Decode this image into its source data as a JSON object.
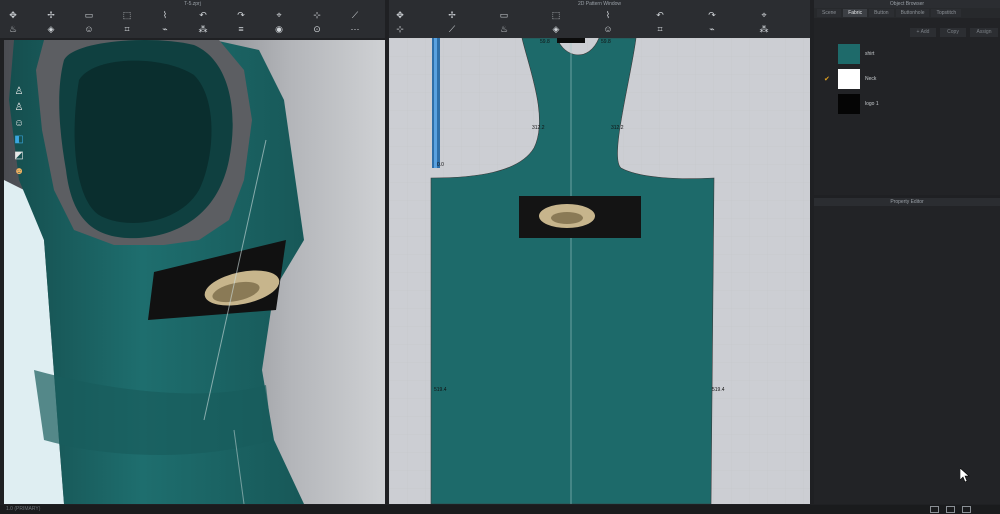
{
  "window3d": {
    "title": "T-5.zprj"
  },
  "window2d": {
    "title": "2D Pattern Window"
  },
  "object_browser": {
    "title": "Object Browser",
    "tabs": [
      "Scene",
      "Fabric",
      "Button",
      "Buttonhole",
      "Topstitch"
    ],
    "active_tab": "Fabric",
    "buttons": {
      "add": "+ Add",
      "copy": "Copy",
      "assign": "Assign"
    },
    "fabrics": [
      {
        "name": "shirt",
        "color": "#1e6a6a",
        "selected": false
      },
      {
        "name": "Neck",
        "color": "#ffffff",
        "selected": true
      },
      {
        "name": "logo 1",
        "color": "#050505",
        "selected": false
      }
    ]
  },
  "property_editor": {
    "title": "Property Editor"
  },
  "measurements": {
    "top_left": "59.8",
    "top_right": "59.8",
    "arm_left": "312.2",
    "arm_right": "312.2",
    "side_left": "519.4",
    "side_right": "519.4",
    "strip": "0.0"
  },
  "status": {
    "text": "1.0 (PRIMARY)"
  },
  "icons": {
    "toolbar3d": [
      "move-icon",
      "transform-icon",
      "box-select-icon",
      "select-icon",
      "fold-icon",
      "undo-icon",
      "redo-icon",
      "pin-icon",
      "pin-select-icon",
      "measure-icon",
      "steam-icon",
      "sim-icon",
      "avatar-icon",
      "tape-icon",
      "zipper-icon",
      "pins-icon",
      "pin-list-icon",
      "button-icon",
      "buttonhole-icon",
      "topstitch-icon"
    ],
    "toolbar2d": [
      "select-icon",
      "transform-icon",
      "edit-point-icon",
      "edit-curve-icon",
      "add-point-icon",
      "spline-icon",
      "segment-icon",
      "rectangle-icon",
      "circle-icon",
      "dart-icon",
      "internal-icon",
      "texture-icon",
      "grain-icon",
      "sewing-icon",
      "pleat-icon",
      "fold-icon"
    ],
    "vertical": [
      "avatar-icon",
      "avatar-icon-2",
      "person-icon",
      "cube-icon",
      "mirror-icon",
      "face-icon"
    ]
  }
}
